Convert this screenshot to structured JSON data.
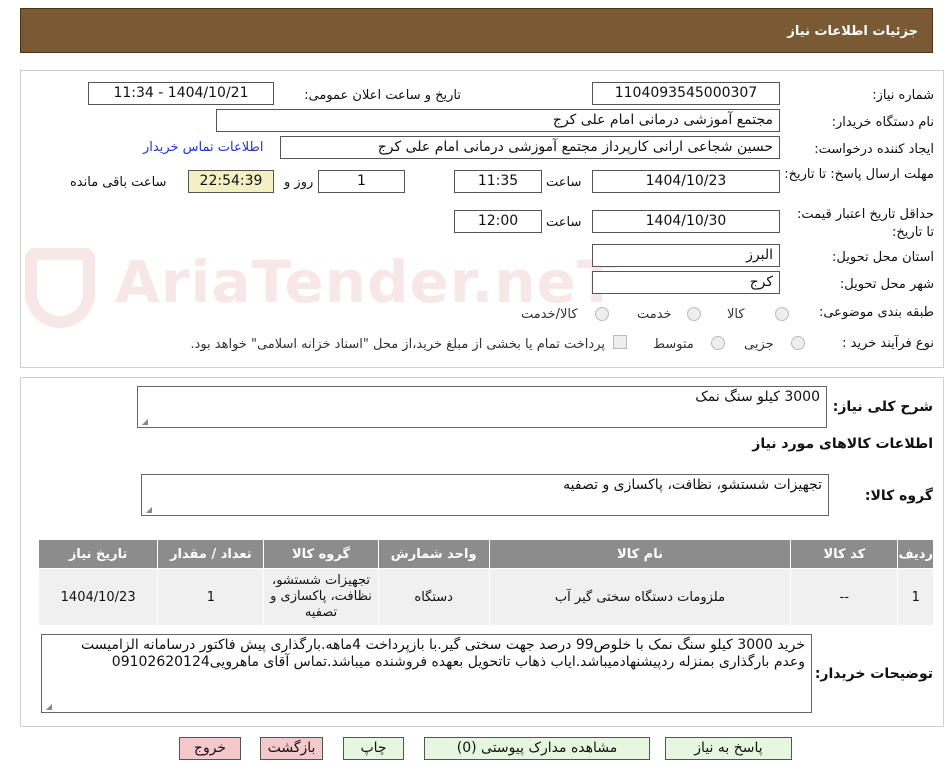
{
  "header": {
    "title": "جزئیات اطلاعات نیاز"
  },
  "watermark": {
    "text": "AriaTender.neT"
  },
  "form": {
    "need_number": {
      "label": "شماره نیاز:",
      "value": "1104093545000307"
    },
    "announce": {
      "label": "تاریخ و ساعت اعلان عمومی:",
      "value": "1404/10/21 - 11:34"
    },
    "buyer": {
      "label": "نام دستگاه خریدار:",
      "value": "مجتمع آموزشی درمانی امام علی کرج"
    },
    "creator": {
      "label": "ایجاد کننده درخواست:",
      "value": "حسین شجاعی ارانی کارپرداز مجتمع آموزشی درمانی امام علی کرج",
      "contact_link": "اطلاعات تماس خریدار"
    },
    "deadline": {
      "label": "مهلت ارسال پاسخ: تا تاریخ:",
      "date": "1404/10/23",
      "time_label": "ساعت",
      "time": "11:35",
      "days": "1",
      "days_label": "روز و",
      "remaining": "22:54:39",
      "remaining_label": "ساعت باقی مانده"
    },
    "validity": {
      "label": "حداقل تاریخ اعتبار قیمت: تا تاریخ:",
      "date": "1404/10/30",
      "time_label": "ساعت",
      "time": "12:00"
    },
    "province": {
      "label": "استان محل تحویل:",
      "value": "البرز"
    },
    "city": {
      "label": "شهر محل تحویل:",
      "value": "کرج"
    },
    "category": {
      "label": "طبقه بندی موضوعی:",
      "options": [
        "کالا",
        "خدمت",
        "کالا/خدمت"
      ]
    },
    "process": {
      "label": "نوع فرآیند خرید :",
      "options": [
        "جزیی",
        "متوسط"
      ],
      "note": "پرداخت تمام یا بخشی از مبلغ خرید،از محل \"اسناد خزانه اسلامی\" خواهد بود."
    }
  },
  "summary": {
    "label": "شرح کلی نیاز:",
    "value": "3000 کیلو سنگ نمک"
  },
  "goods_info": {
    "title": "اطلاعات کالاهای مورد نیاز"
  },
  "goods_group": {
    "label": "گروه کالا:",
    "value": "تجهیزات شستشو، نظافت، پاکسازی و تصفیه"
  },
  "table": {
    "headers": [
      "ردیف",
      "کد کالا",
      "نام کالا",
      "واحد شمارش",
      "گروه کالا",
      "تعداد / مقدار",
      "تاریخ نیاز"
    ],
    "rows": [
      [
        "1",
        "--",
        "ملزومات دستگاه سختی گیر آب",
        "دستگاه",
        "تجهیزات شستشو، نظافت، پاکسازی و تصفیه",
        "1",
        "1404/10/23"
      ]
    ]
  },
  "buyer_notes": {
    "label": "توضیحات خریدار:",
    "value": "خرید 3000 کیلو سنگ نمک با خلوص99 درصد جهت سختی گیر.با بازپرداخت 4ماهه.بارگذاری پیش فاکتور درسامانه الزامیست وعدم بارگذاری بمنزله ردپیشنهادمیباشد.ایاب ذهاب تاتحویل بعهده فروشنده میباشد.تماس آقای ماهرویی09102620124"
  },
  "buttons": {
    "reply": "پاسخ به نیاز",
    "attachments": "مشاهده مدارک پیوستی (0)",
    "print": "چاپ",
    "back": "بازگشت",
    "exit": "خروج"
  }
}
